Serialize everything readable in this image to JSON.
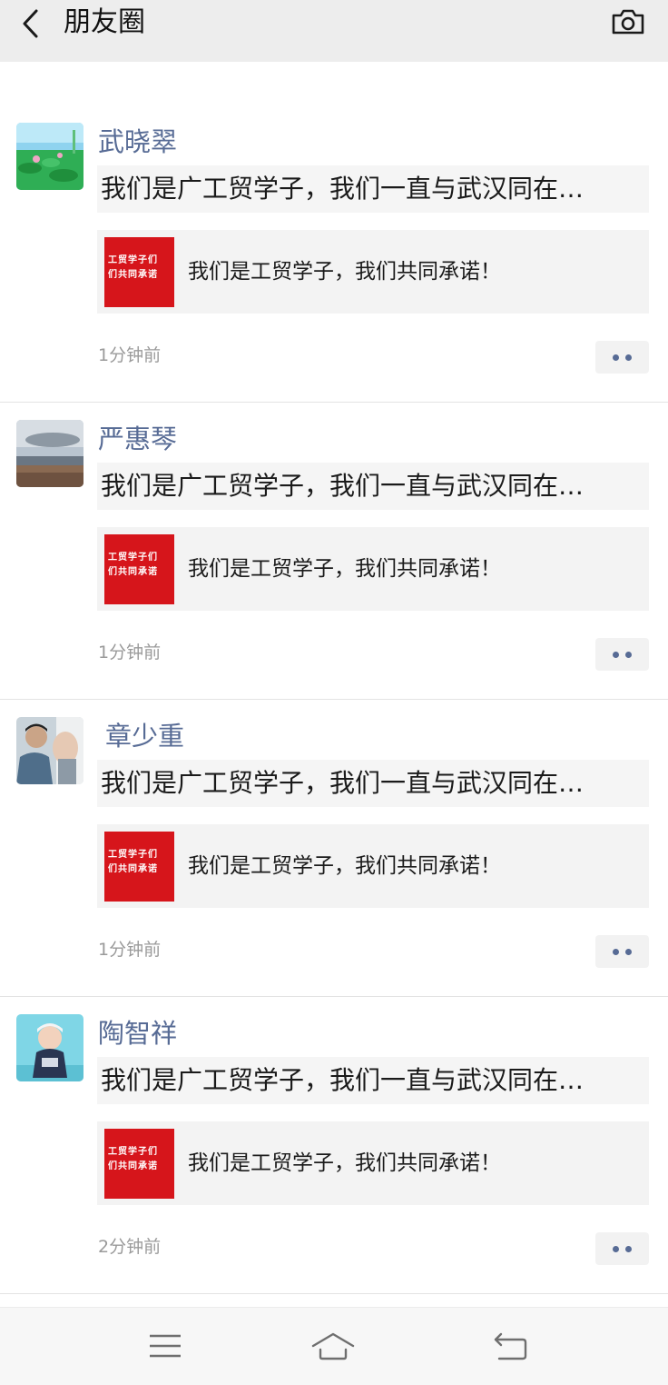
{
  "header": {
    "title": "朋友圈",
    "back_icon": "chevron-left-icon",
    "camera_icon": "camera-icon"
  },
  "colors": {
    "header_bg": "#ededed",
    "username": "#576b95",
    "thumb_red": "#d6151b",
    "timestamp": "#9a9a9a"
  },
  "posts": [
    {
      "username": "武晓翠",
      "text": "我们是广工贸学子，我们一直与武汉同在…",
      "link": {
        "thumb_line1": "工贸学子们",
        "thumb_line2": "们共同承诺",
        "title": "我们是工贸学子，我们共同承诺！"
      },
      "time": "1分钟前"
    },
    {
      "username": "严惠琴",
      "text": "我们是广工贸学子，我们一直与武汉同在…",
      "link": {
        "thumb_line1": "工贸学子们",
        "thumb_line2": "们共同承诺",
        "title": "我们是工贸学子，我们共同承诺！"
      },
      "time": "1分钟前"
    },
    {
      "username": "章少重",
      "text": "我们是广工贸学子，我们一直与武汉同在…",
      "link": {
        "thumb_line1": "工贸学子们",
        "thumb_line2": "们共同承诺",
        "title": "我们是工贸学子，我们共同承诺！"
      },
      "time": "1分钟前"
    },
    {
      "username": "陶智祥",
      "text": "我们是广工贸学子，我们一直与武汉同在…",
      "link": {
        "thumb_line1": "工贸学子们",
        "thumb_line2": "们共同承诺",
        "title": "我们是工贸学子，我们共同承诺！"
      },
      "time": "2分钟前"
    }
  ],
  "navbar": {
    "menu_icon": "menu-icon",
    "home_icon": "home-icon",
    "back_icon": "return-icon"
  }
}
